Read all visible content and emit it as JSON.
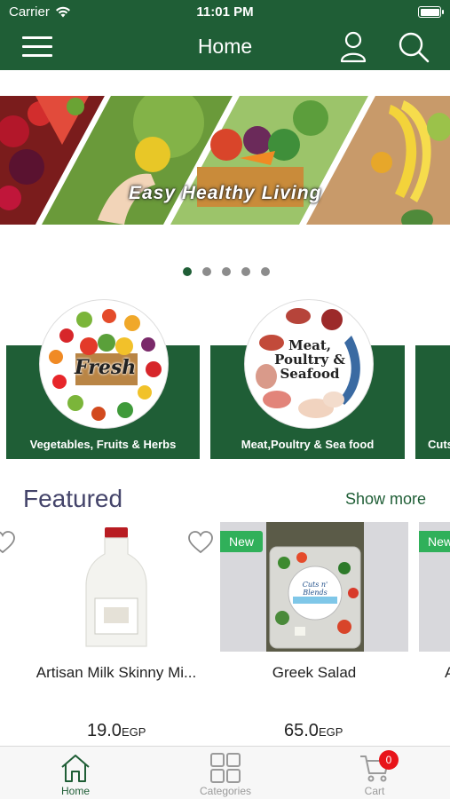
{
  "status_bar": {
    "carrier": "Carrier",
    "time": "11:01 PM"
  },
  "nav": {
    "title": "Home",
    "menu_icon": "hamburger-menu-icon",
    "user_icon": "user-icon",
    "search_icon": "search-icon"
  },
  "banner": {
    "caption": "Easy Healthy Living",
    "slide_count": 5,
    "active_slide": 1
  },
  "categories": [
    {
      "label": "Vegetables, Fruits & Herbs",
      "circle_text": "Fresh"
    },
    {
      "label": "Meat,Poultry & Sea food",
      "circle_text": "Meat, Poultry & Seafood"
    },
    {
      "label": "Cuts"
    }
  ],
  "featured": {
    "title": "Featured",
    "show_more": "Show more",
    "products": [
      {
        "name": "Artisan Milk Skinny Mi...",
        "price": "19.0",
        "currency": "EGP",
        "badge": ""
      },
      {
        "name": "Greek Salad",
        "price": "65.0",
        "currency": "EGP",
        "badge": "New",
        "label_text": "Cuts n' Blends"
      },
      {
        "name": "A",
        "price": "",
        "currency": "",
        "badge": "New"
      }
    ]
  },
  "tab_bar": {
    "tabs": [
      {
        "label": "Home",
        "icon": "home-icon",
        "active": true
      },
      {
        "label": "Categories",
        "icon": "grid-icon",
        "active": false
      },
      {
        "label": "Cart",
        "icon": "cart-icon",
        "active": false,
        "badge": "0"
      }
    ]
  },
  "colors": {
    "brand_green": "#1f5e36",
    "badge_green": "#30b05a",
    "badge_red": "#e8141a",
    "title_purple": "#44446a"
  }
}
